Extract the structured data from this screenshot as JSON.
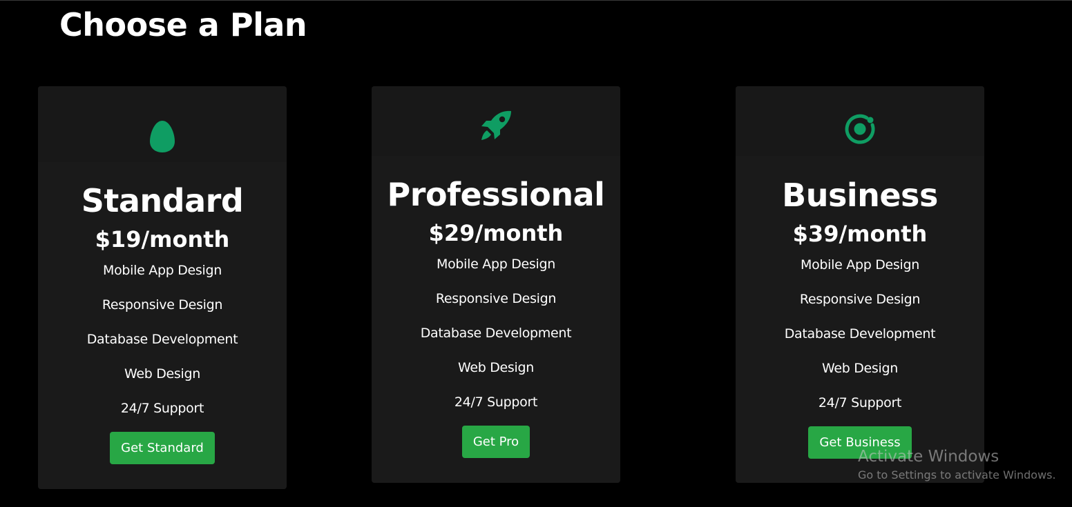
{
  "page": {
    "title": "Choose a Plan"
  },
  "plans": [
    {
      "icon": "egg-icon",
      "name": "Standard",
      "price": "$19/month",
      "features": [
        "Mobile App Design",
        "Responsive Design",
        "Database Development",
        "Web Design",
        "24/7 Support"
      ],
      "cta": "Get Standard"
    },
    {
      "icon": "rocket-icon",
      "name": "Professional",
      "price": "$29/month",
      "features": [
        "Mobile App Design",
        "Responsive Design",
        "Database Development",
        "Web Design",
        "24/7 Support"
      ],
      "cta": "Get Pro"
    },
    {
      "icon": "ionic-logo-icon",
      "name": "Business",
      "price": "$39/month",
      "features": [
        "Mobile App Design",
        "Responsive Design",
        "Database Development",
        "Web Design",
        "24/7 Support"
      ],
      "cta": "Get Business"
    }
  ],
  "watermark": {
    "title": "Activate Windows",
    "subtitle": "Go to Settings to activate Windows."
  },
  "colors": {
    "background": "#000000",
    "card": "#1a1a1a",
    "accent_icon": "#0f9d63",
    "button": "#28a745"
  }
}
